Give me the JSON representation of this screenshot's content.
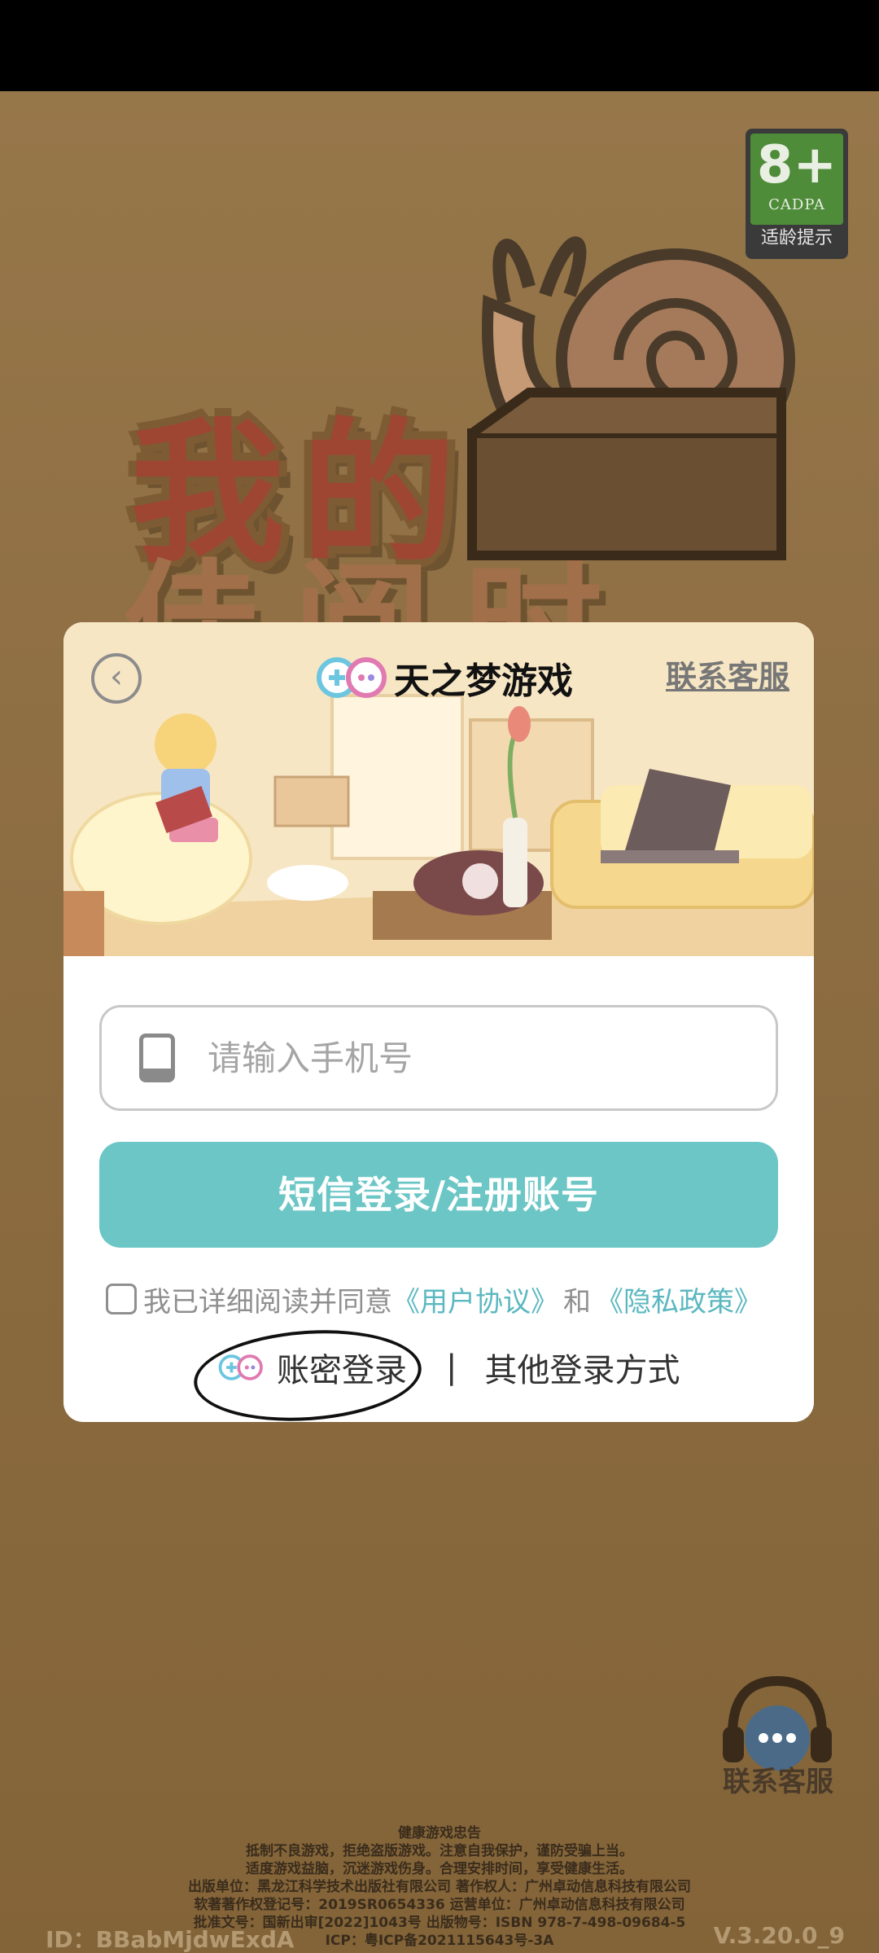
{
  "age_rating": {
    "number": "8+",
    "org": "CADPA",
    "label": "适龄提示"
  },
  "game_title": {
    "line1": "我的",
    "line2": "佳阅时光"
  },
  "dialog": {
    "brand_name": "天之梦游戏",
    "contact_link": "联系客服",
    "phone_placeholder": "请输入手机号",
    "sms_login_label": "短信登录/注册账号",
    "agree_prefix": "我已详细阅读并同意",
    "user_agreement": "《用户协议》",
    "and_text": "和",
    "privacy_policy": "《隐私政策》",
    "account_login": "账密登录",
    "separator": "|",
    "other_login": "其他登录方式"
  },
  "float_service": {
    "label": "联系客服"
  },
  "footer": {
    "lines": [
      "健康游戏忠告",
      "抵制不良游戏，拒绝盗版游戏。注意自我保护，谨防受骗上当。",
      "适度游戏益脑，沉迷游戏伤身。合理安排时间，享受健康生活。",
      "出版单位：黑龙江科学技术出版社有限公司   著作权人：广州卓动信息科技有限公司",
      "软著著作权登记号：2019SR0654336   运营单位：广州卓动信息科技有限公司",
      "批准文号：国新出审[2022]1043号   出版物号：ISBN 978-7-498-09684-5",
      "ICP：粤ICP备2021115643号-3A"
    ],
    "id": "ID：BBabMjdwExdA",
    "version": "V.3.20.0_9"
  },
  "colors": {
    "accent": "#6cc6c6",
    "link": "#5bb8c0",
    "background": "#8a6a3e"
  }
}
